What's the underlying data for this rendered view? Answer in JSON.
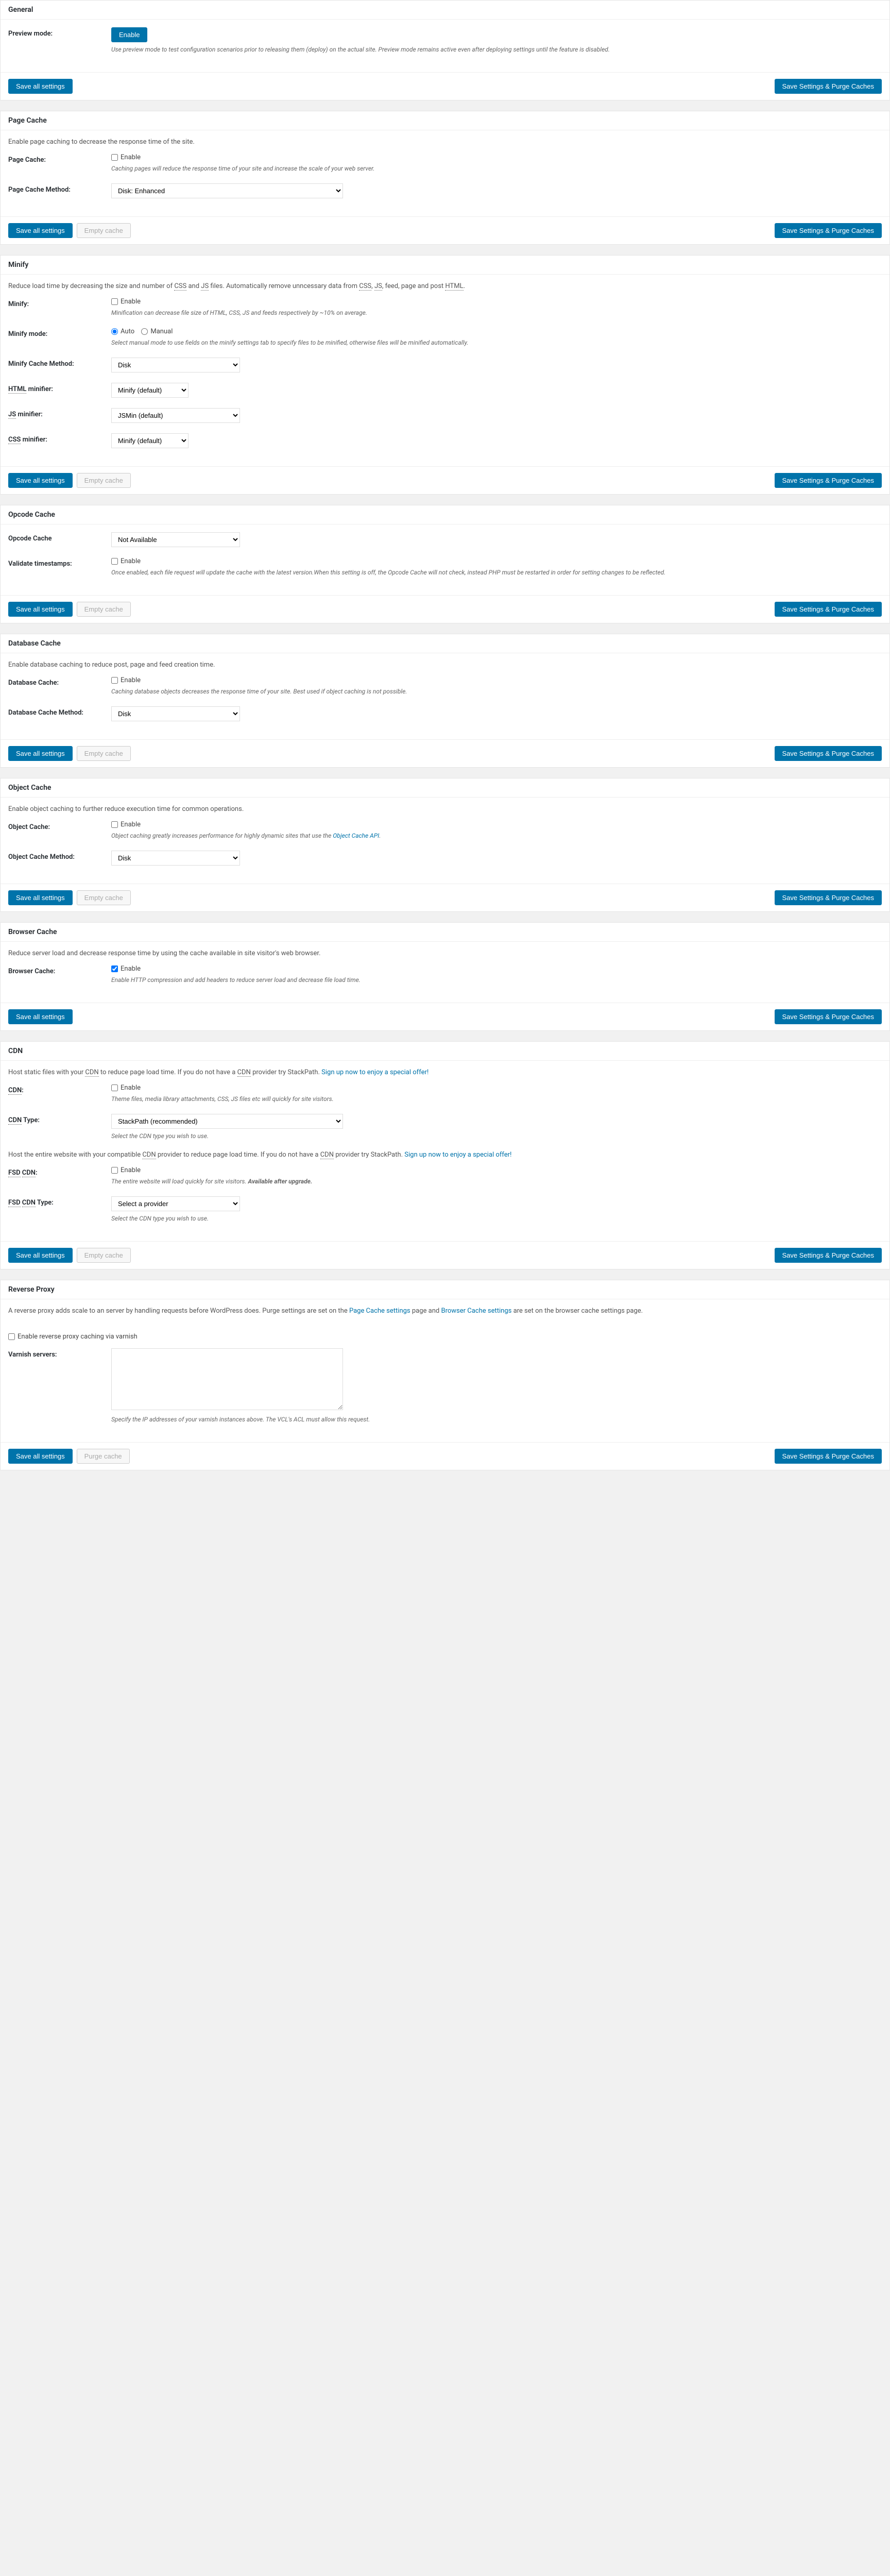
{
  "buttons": {
    "save_all": "Save all settings",
    "save_purge": "Save Settings & Purge Caches",
    "empty_cache": "Empty cache",
    "purge_cache": "Purge cache",
    "enable_btn": "Enable"
  },
  "labels": {
    "enable": "Enable",
    "auto": "Auto",
    "manual": "Manual"
  },
  "general": {
    "title": "General",
    "preview_label": "Preview mode:",
    "preview_desc": "Use preview mode to test configuration scenarios prior to releasing them (deploy) on the actual site. Preview mode remains active even after deploying settings until the feature is disabled."
  },
  "page_cache": {
    "title": "Page Cache",
    "intro": "Enable page caching to decrease the response time of the site.",
    "cache_label": "Page Cache:",
    "cache_desc": "Caching pages will reduce the response time of your site and increase the scale of your web server.",
    "method_label": "Page Cache Method:",
    "method_value": "Disk: Enhanced"
  },
  "minify": {
    "title": "Minify",
    "intro_a": "Reduce load time by decreasing the size and number of ",
    "intro_b": " and ",
    "intro_c": " files. Automatically remove unncessary data from ",
    "intro_d": ", feed, page and post ",
    "css": "CSS",
    "js": "JS",
    "html": "HTML",
    "minify_label": "Minify:",
    "minify_desc": "Minification can decrease file size of HTML, CSS, JS and feeds respectively by ~10% on average.",
    "mode_label": "Minify mode:",
    "mode_desc": "Select manual mode to use fields on the minify settings tab to specify files to be minified, otherwise files will be minified automatically.",
    "cache_method_label": "Minify Cache Method:",
    "cache_method_value": "Disk",
    "html_minifier_label": "HTML minifier:",
    "html_minifier_value": "Minify (default)",
    "js_minifier_label": "JS minifier:",
    "js_minifier_value": "JSMin (default)",
    "css_minifier_label": "CSS minifier:",
    "css_minifier_value": "Minify (default)"
  },
  "opcode": {
    "title": "Opcode Cache",
    "cache_label": "Opcode Cache",
    "cache_value": "Not Available",
    "validate_label": "Validate timestamps:",
    "validate_desc": "Once enabled, each file request will update the cache with the latest version.When this setting is off, the Opcode Cache will not check, instead PHP must be restarted in order for setting changes to be reflected."
  },
  "db_cache": {
    "title": "Database Cache",
    "intro": "Enable database caching to reduce post, page and feed creation time.",
    "cache_label": "Database Cache:",
    "cache_desc": "Caching database objects decreases the response time of your site. Best used if object caching is not possible.",
    "method_label": "Database Cache Method:",
    "method_value": "Disk"
  },
  "obj_cache": {
    "title": "Object Cache",
    "intro": "Enable object caching to further reduce execution time for common operations.",
    "cache_label": "Object Cache:",
    "cache_desc_a": "Object caching greatly increases performance for highly dynamic sites that use the ",
    "cache_link": "Object Cache API",
    "cache_desc_b": ".",
    "method_label": "Object Cache Method:",
    "method_value": "Disk"
  },
  "browser_cache": {
    "title": "Browser Cache",
    "intro": "Reduce server load and decrease response time by using the cache available in site visitor's web browser.",
    "cache_label": "Browser Cache:",
    "cache_desc": "Enable HTTP compression and add headers to reduce server load and decrease file load time."
  },
  "cdn": {
    "title": "CDN",
    "intro_a": "Host static files with your ",
    "intro_b": " to reduce page load time. If you do not have a ",
    "intro_c": " provider try StackPath. ",
    "signup": "Sign up now to enjoy a special offer!",
    "cdn_label": "CDN:",
    "cdn_desc": "Theme files, media library attachments, CSS, JS files etc will quickly for site visitors.",
    "type_label": "CDN Type:",
    "type_value": "StackPath (recommended)",
    "type_desc": "Select the CDN type you wish to use.",
    "fsd_intro_a": "Host the entire website with your compatible ",
    "fsd_intro_b": " provider to reduce page load time. If you do not have a ",
    "fsd_intro_c": " provider try StackPath. ",
    "fsd_label": "FSD CDN:",
    "fsd_desc_a": "The entire website will load quickly for site visitors. ",
    "fsd_desc_b": "Available after upgrade.",
    "fsd_type_label": "FSD CDN Type:",
    "fsd_type_value": "Select a provider",
    "fsd_type_desc": "Select the CDN type you wish to use.",
    "abbr": "CDN"
  },
  "reverse_proxy": {
    "title": "Reverse Proxy",
    "intro_a": "A reverse proxy adds scale to an server by handling requests before WordPress does. Purge settings are set on the ",
    "intro_link1": "Page Cache settings",
    "intro_b": " page and ",
    "intro_link2": "Browser Cache settings",
    "intro_c": " are set on the browser cache settings page.",
    "enable_label": "Enable reverse proxy caching via varnish",
    "servers_label": "Varnish servers:",
    "servers_desc": "Specify the IP addresses of your varnish instances above. The VCL's ACL must allow this request."
  }
}
